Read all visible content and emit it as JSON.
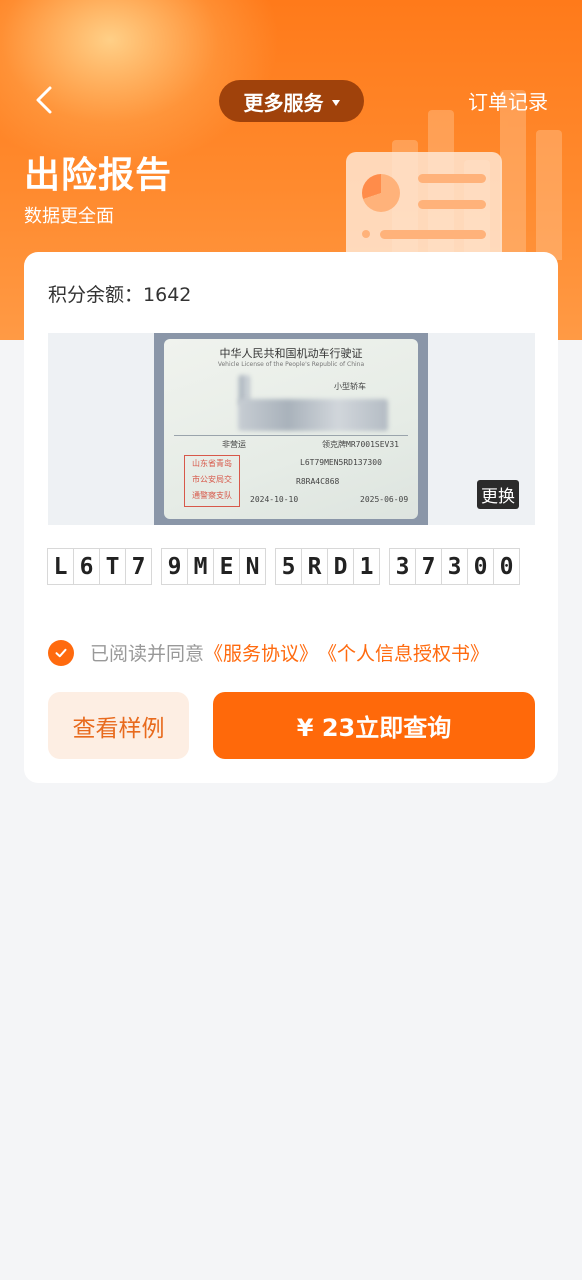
{
  "header": {
    "back_icon": "chevron-left-icon",
    "more_services_label": "更多服务",
    "order_records_label": "订单记录",
    "title": "出险报告",
    "subtitle": "数据更全面"
  },
  "account": {
    "points_label": "积分余额：",
    "points_value": "1642"
  },
  "license_photo": {
    "title": "中华人民共和国机动车行驶证",
    "title_en": "Vehicle License of the People's Republic of China",
    "vehicle_type": "小型轿车",
    "use_nature": "非营运",
    "model": "领克牌MR7001SEV31",
    "vin": "L6T79MEN5RD137300",
    "engine_no": "R8RA4C868",
    "register_date": "2024-10-10",
    "issue_date": "2025-06-09",
    "stamp_lines": [
      "山东省青岛",
      "市公安局交",
      "通警察支队"
    ],
    "change_label": "更换"
  },
  "vin_groups": [
    [
      "L",
      "6",
      "T",
      "7"
    ],
    [
      "9",
      "M",
      "E",
      "N"
    ],
    [
      "5",
      "R",
      "D",
      "1"
    ],
    [
      "3",
      "7",
      "3",
      "0",
      "0"
    ]
  ],
  "agreement": {
    "checked": true,
    "prefix": "已阅读并同意",
    "service_agreement": "《服务协议》",
    "privacy_auth": "《个人信息授权书》"
  },
  "actions": {
    "sample_label": "查看样例",
    "query_label": "¥ 23立即查询"
  },
  "colors": {
    "brand_orange": "#ff690a",
    "header_pill": "#a0420b",
    "page_bg": "#f4f5f7"
  }
}
